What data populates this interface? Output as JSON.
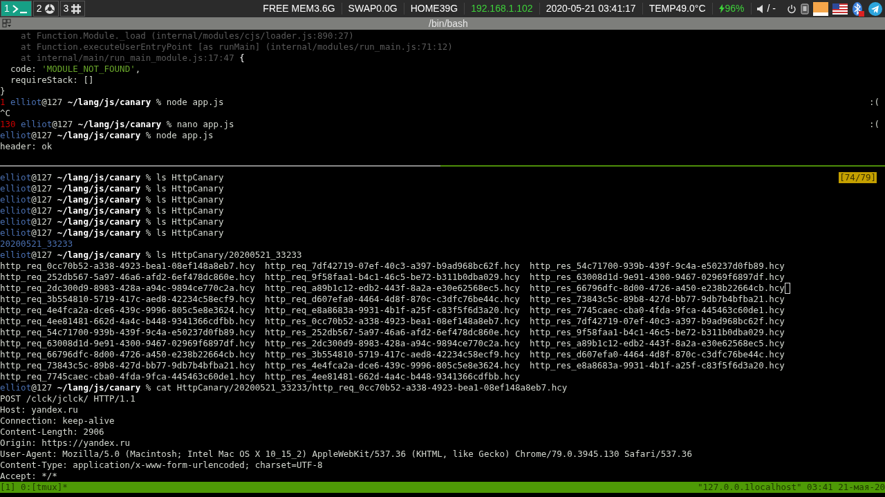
{
  "top_bar": {
    "workspaces": [
      {
        "number": "1",
        "kind": "terminal",
        "selected": true
      },
      {
        "number": "2",
        "kind": "browser",
        "selected": false
      },
      {
        "number": "3",
        "kind": "chat",
        "selected": false
      }
    ],
    "stats": [
      {
        "kind": "text",
        "text": "FREE MEM3.6G"
      },
      {
        "kind": "text",
        "text": "SWAP0.0G"
      },
      {
        "kind": "text",
        "text": "HOME39G"
      },
      {
        "kind": "text",
        "text": "192.168.1.102",
        "color": "#3ed13a"
      },
      {
        "kind": "text",
        "text": "2020-05-21 03:41:17"
      },
      {
        "kind": "text",
        "text": "TEMP49.0°C"
      },
      {
        "kind": "battery",
        "text": "96%",
        "color": "#3ed13a"
      },
      {
        "kind": "volume",
        "text": "/ -"
      }
    ]
  },
  "window": {
    "title": "/bin/bash"
  },
  "top_pane": {
    "lines": [
      {
        "kind": "dim",
        "text": "    at Function.Module._load (internal/modules/cjs/loader.js:890:27)"
      },
      {
        "kind": "dim",
        "text": "    at Function.executeUserEntryPoint [as runMain] (internal/modules/run_main.js:71:12)"
      },
      {
        "kind": "dim_brace",
        "text": "    at internal/main/run_main_module.js:17:47",
        "brace": " {"
      },
      {
        "kind": "field",
        "key": "  code: ",
        "value": "'MODULE_NOT_FOUND'",
        "suffix": ","
      },
      {
        "kind": "output",
        "text": "  requireStack: []"
      },
      {
        "kind": "output",
        "text": "}"
      },
      {
        "kind": "prompt",
        "exit_code": "1",
        "user": "elliot",
        "host": "@127",
        "path": "~/lang/js/canary",
        "command": "% node app.js",
        "right": ":("
      },
      {
        "kind": "output",
        "text": "^C"
      },
      {
        "kind": "prompt",
        "exit_code": "130",
        "user": "elliot",
        "host": "@127",
        "path": "~/lang/js/canary",
        "command": "% nano app.js",
        "right": ":("
      },
      {
        "kind": "prompt",
        "user": "elliot",
        "host": "@127",
        "path": "~/lang/js/canary",
        "command": "% node app.js"
      },
      {
        "kind": "output",
        "text": "header: ok"
      }
    ]
  },
  "bottom_pane": {
    "position": "[74/79]",
    "lines": [
      {
        "kind": "prompt",
        "user": "elliot",
        "host": "@127",
        "path": "~/lang/js/canary",
        "command": "% ls HttpCanary"
      },
      {
        "kind": "prompt",
        "user": "elliot",
        "host": "@127",
        "path": "~/lang/js/canary",
        "command": "% ls HttpCanary"
      },
      {
        "kind": "prompt",
        "user": "elliot",
        "host": "@127",
        "path": "~/lang/js/canary",
        "command": "% ls HttpCanary"
      },
      {
        "kind": "prompt",
        "user": "elliot",
        "host": "@127",
        "path": "~/lang/js/canary",
        "command": "% ls HttpCanary"
      },
      {
        "kind": "prompt",
        "user": "elliot",
        "host": "@127",
        "path": "~/lang/js/canary",
        "command": "% ls HttpCanary"
      },
      {
        "kind": "prompt",
        "user": "elliot",
        "host": "@127",
        "path": "~/lang/js/canary",
        "command": "% ls HttpCanary"
      },
      {
        "kind": "dir",
        "text": "20200521_33233"
      },
      {
        "kind": "prompt",
        "user": "elliot",
        "host": "@127",
        "path": "~/lang/js/canary",
        "command": "% ls HttpCanary/20200521_33233"
      },
      {
        "kind": "columns",
        "cursor": false,
        "cells": [
          "http_req_0cc70b52-a338-4923-bea1-08ef148a8eb7.hcy",
          "http_req_7df42719-07ef-40c3-a397-b9ad968bc62f.hcy",
          "http_res_54c71700-939b-439f-9c4a-e50237d0fb89.hcy"
        ]
      },
      {
        "kind": "columns",
        "cursor": false,
        "cells": [
          "http_req_252db567-5a97-46a6-afd2-6ef478dc860e.hcy",
          "http_req_9f58faa1-b4c1-46c5-be72-b311b0dba029.hcy",
          "http_res_63008d1d-9e91-4300-9467-02969f6897df.hcy"
        ]
      },
      {
        "kind": "columns",
        "cursor": true,
        "cells": [
          "http_req_2dc300d9-8983-428a-a94c-9894ce770c2a.hcy",
          "http_req_a89b1c12-edb2-443f-8a2a-e30e62568ec5.hcy",
          "http_res_66796dfc-8d00-4726-a450-e238b22664cb.hcy"
        ]
      },
      {
        "kind": "columns",
        "cursor": false,
        "cells": [
          "http_req_3b554810-5719-417c-aed8-42234c58ecf9.hcy",
          "http_req_d607efa0-4464-4d8f-870c-c3dfc76be44c.hcy",
          "http_res_73843c5c-89b8-427d-bb77-9db7b4bfba21.hcy"
        ]
      },
      {
        "kind": "columns",
        "cursor": false,
        "cells": [
          "http_req_4e4fca2a-dce6-439c-9996-805c5e8e3624.hcy",
          "http_req_e8a8683a-9931-4b1f-a25f-c83f5f6d3a20.hcy",
          "http_res_7745caec-cba0-4fda-9fca-445463c60de1.hcy"
        ]
      },
      {
        "kind": "columns",
        "cursor": false,
        "cells": [
          "http_req_4ee81481-662d-4a4c-b448-9341366cdfbb.hcy",
          "http_res_0cc70b52-a338-4923-bea1-08ef148a8eb7.hcy",
          "http_res_7df42719-07ef-40c3-a397-b9ad968bc62f.hcy"
        ]
      },
      {
        "kind": "columns",
        "cursor": false,
        "cells": [
          "http_req_54c71700-939b-439f-9c4a-e50237d0fb89.hcy",
          "http_res_252db567-5a97-46a6-afd2-6ef478dc860e.hcy",
          "http_res_9f58faa1-b4c1-46c5-be72-b311b0dba029.hcy"
        ]
      },
      {
        "kind": "columns",
        "cursor": false,
        "cells": [
          "http_req_63008d1d-9e91-4300-9467-02969f6897df.hcy",
          "http_res_2dc300d9-8983-428a-a94c-9894ce770c2a.hcy",
          "http_res_a89b1c12-edb2-443f-8a2a-e30e62568ec5.hcy"
        ]
      },
      {
        "kind": "columns",
        "cursor": false,
        "cells": [
          "http_req_66796dfc-8d00-4726-a450-e238b22664cb.hcy",
          "http_res_3b554810-5719-417c-aed8-42234c58ecf9.hcy",
          "http_res_d607efa0-4464-4d8f-870c-c3dfc76be44c.hcy"
        ]
      },
      {
        "kind": "columns",
        "cursor": false,
        "cells": [
          "http_req_73843c5c-89b8-427d-bb77-9db7b4bfba21.hcy",
          "http_res_4e4fca2a-dce6-439c-9996-805c5e8e3624.hcy",
          "http_res_e8a8683a-9931-4b1f-a25f-c83f5f6d3a20.hcy"
        ]
      },
      {
        "kind": "columns",
        "cursor": false,
        "cells": [
          "http_req_7745caec-cba0-4fda-9fca-445463c60de1.hcy",
          "http_res_4ee81481-662d-4a4c-b448-9341366cdfbb.hcy"
        ]
      },
      {
        "kind": "prompt",
        "user": "elliot",
        "host": "@127",
        "path": "~/lang/js/canary",
        "command": "% cat HttpCanary/20200521_33233/http_req_0cc70b52-a338-4923-bea1-08ef148a8eb7.hcy"
      },
      {
        "kind": "output",
        "text": "POST /clck/jclck/ HTTP/1.1"
      },
      {
        "kind": "output",
        "text": "Host: yandex.ru"
      },
      {
        "kind": "output",
        "text": "Connection: keep-alive"
      },
      {
        "kind": "output",
        "text": "Content-Length: 2906"
      },
      {
        "kind": "output",
        "text": "Origin: https://yandex.ru"
      },
      {
        "kind": "output",
        "text": "User-Agent: Mozilla/5.0 (Macintosh; Intel Mac OS X 10_15_2) AppleWebKit/537.36 (KHTML, like Gecko) Chrome/79.0.3945.130 Safari/537.36"
      },
      {
        "kind": "output",
        "text": "Content-Type: application/x-www-form-urlencoded; charset=UTF-8"
      },
      {
        "kind": "output",
        "text": "Accept: */*"
      }
    ]
  },
  "status_bar": {
    "left": "[1] 0:[tmux]*",
    "right": "\"127.0.0.1localhost\" 03:41 21-мая-20"
  }
}
